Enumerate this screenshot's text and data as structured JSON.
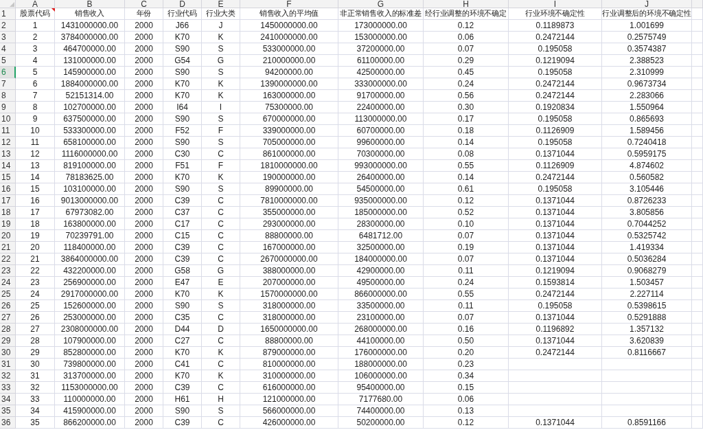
{
  "header_row_number": "1",
  "columns": [
    {
      "letter": "A",
      "header": "股票代码",
      "comment": true
    },
    {
      "letter": "B",
      "header": "销售收入",
      "comment": false
    },
    {
      "letter": "C",
      "header": "年份",
      "comment": false
    },
    {
      "letter": "D",
      "header": "行业代码",
      "comment": false
    },
    {
      "letter": "E",
      "header": "行业大类",
      "comment": false
    },
    {
      "letter": "F",
      "header": "销售收入的平均值",
      "comment": false
    },
    {
      "letter": "G",
      "header": "非正常销售收入的标准差",
      "comment": false
    },
    {
      "letter": "H",
      "header": "经行业调整的环境不确定",
      "comment": false
    },
    {
      "letter": "I",
      "header": "行业环境不确定性",
      "comment": false
    },
    {
      "letter": "J",
      "header": "行业调整后的环境不确定性",
      "comment": false
    }
  ],
  "rows": [
    {
      "number": "2",
      "selected": false,
      "cells": [
        "1",
        "1431000000.00",
        "2000",
        "J66",
        "J",
        "1450000000.00",
        "173000000.00",
        "0.12",
        "0.1189873",
        "1.001699"
      ]
    },
    {
      "number": "3",
      "selected": false,
      "cells": [
        "2",
        "3784000000.00",
        "2000",
        "K70",
        "K",
        "2410000000.00",
        "153000000.00",
        "0.06",
        "0.2472144",
        "0.2575749"
      ]
    },
    {
      "number": "4",
      "selected": false,
      "cells": [
        "3",
        "464700000.00",
        "2000",
        "S90",
        "S",
        "533000000.00",
        "37200000.00",
        "0.07",
        "0.195058",
        "0.3574387"
      ]
    },
    {
      "number": "5",
      "selected": false,
      "cells": [
        "4",
        "131000000.00",
        "2000",
        "G54",
        "G",
        "210000000.00",
        "61100000.00",
        "0.29",
        "0.1219094",
        "2.388523"
      ]
    },
    {
      "number": "6",
      "selected": true,
      "cells": [
        "5",
        "145900000.00",
        "2000",
        "S90",
        "S",
        "94200000.00",
        "42500000.00",
        "0.45",
        "0.195058",
        "2.310999"
      ]
    },
    {
      "number": "7",
      "selected": false,
      "cells": [
        "6",
        "1884000000.00",
        "2000",
        "K70",
        "K",
        "1390000000.00",
        "333000000.00",
        "0.24",
        "0.2472144",
        "0.9673734"
      ]
    },
    {
      "number": "8",
      "selected": false,
      "cells": [
        "7",
        "52151314.00",
        "2000",
        "K70",
        "K",
        "163000000.00",
        "91700000.00",
        "0.56",
        "0.2472144",
        "2.283066"
      ]
    },
    {
      "number": "9",
      "selected": false,
      "cells": [
        "8",
        "102700000.00",
        "2000",
        "I64",
        "I",
        "75300000.00",
        "22400000.00",
        "0.30",
        "0.1920834",
        "1.550964"
      ]
    },
    {
      "number": "10",
      "selected": false,
      "cells": [
        "9",
        "637500000.00",
        "2000",
        "S90",
        "S",
        "670000000.00",
        "113000000.00",
        "0.17",
        "0.195058",
        "0.865693"
      ]
    },
    {
      "number": "11",
      "selected": false,
      "cells": [
        "10",
        "533300000.00",
        "2000",
        "F52",
        "F",
        "339000000.00",
        "60700000.00",
        "0.18",
        "0.1126909",
        "1.589456"
      ]
    },
    {
      "number": "12",
      "selected": false,
      "cells": [
        "11",
        "658100000.00",
        "2000",
        "S90",
        "S",
        "705000000.00",
        "99600000.00",
        "0.14",
        "0.195058",
        "0.7240418"
      ]
    },
    {
      "number": "13",
      "selected": false,
      "cells": [
        "12",
        "1116000000.00",
        "2000",
        "C30",
        "C",
        "861000000.00",
        "70300000.00",
        "0.08",
        "0.1371044",
        "0.5959175"
      ]
    },
    {
      "number": "14",
      "selected": false,
      "cells": [
        "13",
        "819100000.00",
        "2000",
        "F51",
        "F",
        "1810000000.00",
        "993000000.00",
        "0.55",
        "0.1126909",
        "4.874602"
      ]
    },
    {
      "number": "15",
      "selected": false,
      "cells": [
        "14",
        "78183625.00",
        "2000",
        "K70",
        "K",
        "190000000.00",
        "26400000.00",
        "0.14",
        "0.2472144",
        "0.560582"
      ]
    },
    {
      "number": "16",
      "selected": false,
      "cells": [
        "15",
        "103100000.00",
        "2000",
        "S90",
        "S",
        "89900000.00",
        "54500000.00",
        "0.61",
        "0.195058",
        "3.105446"
      ]
    },
    {
      "number": "17",
      "selected": false,
      "cells": [
        "16",
        "9013000000.00",
        "2000",
        "C39",
        "C",
        "7810000000.00",
        "935000000.00",
        "0.12",
        "0.1371044",
        "0.8726233"
      ]
    },
    {
      "number": "18",
      "selected": false,
      "cells": [
        "17",
        "67973082.00",
        "2000",
        "C37",
        "C",
        "355000000.00",
        "185000000.00",
        "0.52",
        "0.1371044",
        "3.805856"
      ]
    },
    {
      "number": "19",
      "selected": false,
      "cells": [
        "18",
        "163800000.00",
        "2000",
        "C17",
        "C",
        "293000000.00",
        "28300000.00",
        "0.10",
        "0.1371044",
        "0.7044252"
      ]
    },
    {
      "number": "20",
      "selected": false,
      "cells": [
        "19",
        "70239791.00",
        "2000",
        "C15",
        "C",
        "88800000.00",
        "6481712.00",
        "0.07",
        "0.1371044",
        "0.5325742"
      ]
    },
    {
      "number": "21",
      "selected": false,
      "cells": [
        "20",
        "118400000.00",
        "2000",
        "C39",
        "C",
        "167000000.00",
        "32500000.00",
        "0.19",
        "0.1371044",
        "1.419334"
      ]
    },
    {
      "number": "22",
      "selected": false,
      "cells": [
        "21",
        "3864000000.00",
        "2000",
        "C39",
        "C",
        "2670000000.00",
        "184000000.00",
        "0.07",
        "0.1371044",
        "0.5036284"
      ]
    },
    {
      "number": "23",
      "selected": false,
      "cells": [
        "22",
        "432200000.00",
        "2000",
        "G58",
        "G",
        "388000000.00",
        "42900000.00",
        "0.11",
        "0.1219094",
        "0.9068279"
      ]
    },
    {
      "number": "24",
      "selected": false,
      "cells": [
        "23",
        "256900000.00",
        "2000",
        "E47",
        "E",
        "207000000.00",
        "49500000.00",
        "0.24",
        "0.1593814",
        "1.503457"
      ]
    },
    {
      "number": "25",
      "selected": false,
      "cells": [
        "24",
        "2917000000.00",
        "2000",
        "K70",
        "K",
        "1570000000.00",
        "866000000.00",
        "0.55",
        "0.2472144",
        "2.227114"
      ]
    },
    {
      "number": "26",
      "selected": false,
      "cells": [
        "25",
        "152600000.00",
        "2000",
        "S90",
        "S",
        "318000000.00",
        "33500000.00",
        "0.11",
        "0.195058",
        "0.5398615"
      ]
    },
    {
      "number": "27",
      "selected": false,
      "cells": [
        "26",
        "253000000.00",
        "2000",
        "C35",
        "C",
        "318000000.00",
        "23100000.00",
        "0.07",
        "0.1371044",
        "0.5291888"
      ]
    },
    {
      "number": "28",
      "selected": false,
      "cells": [
        "27",
        "2308000000.00",
        "2000",
        "D44",
        "D",
        "1650000000.00",
        "268000000.00",
        "0.16",
        "0.1196892",
        "1.357132"
      ]
    },
    {
      "number": "29",
      "selected": false,
      "cells": [
        "28",
        "107900000.00",
        "2000",
        "C27",
        "C",
        "88800000.00",
        "44100000.00",
        "0.50",
        "0.1371044",
        "3.620839"
      ]
    },
    {
      "number": "30",
      "selected": false,
      "cells": [
        "29",
        "852800000.00",
        "2000",
        "K70",
        "K",
        "879000000.00",
        "176000000.00",
        "0.20",
        "0.2472144",
        "0.8116667"
      ]
    },
    {
      "number": "31",
      "selected": false,
      "cells": [
        "30",
        "739800000.00",
        "2000",
        "C41",
        "C",
        "810000000.00",
        "188000000.00",
        "0.23"
      ]
    },
    {
      "number": "32",
      "selected": false,
      "cells": [
        "31",
        "313700000.00",
        "2000",
        "K70",
        "K",
        "310000000.00",
        "106000000.00",
        "0.34"
      ]
    },
    {
      "number": "33",
      "selected": false,
      "cells": [
        "32",
        "1153000000.00",
        "2000",
        "C39",
        "C",
        "616000000.00",
        "95400000.00",
        "0.15"
      ]
    },
    {
      "number": "34",
      "selected": false,
      "cells": [
        "33",
        "110000000.00",
        "2000",
        "H61",
        "H",
        "121000000.00",
        "7177680.00",
        "0.06"
      ]
    },
    {
      "number": "35",
      "selected": false,
      "cells": [
        "34",
        "415900000.00",
        "2000",
        "S90",
        "S",
        "566000000.00",
        "74400000.00",
        "0.13"
      ]
    },
    {
      "number": "36",
      "selected": false,
      "cells": [
        "35",
        "866200000.00",
        "2000",
        "C39",
        "C",
        "426000000.00",
        "50200000.00",
        "0.12",
        "0.1371044",
        "0.8591166"
      ]
    }
  ]
}
